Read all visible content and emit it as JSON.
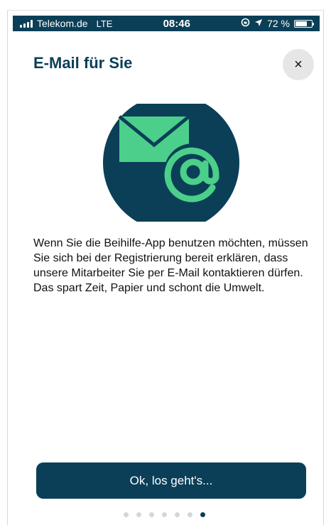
{
  "status_bar": {
    "carrier": "Telekom.de",
    "network": "LTE",
    "time": "08:46",
    "battery": "72 %",
    "battery_level_percent": 72,
    "icons": [
      "signal-icon",
      "orientation-lock-icon",
      "location-icon",
      "battery-icon"
    ]
  },
  "screen": {
    "title": "E-Mail für Sie",
    "close_label": "×",
    "body": "Wenn Sie die Beihilfe-App benutzen möchten, müssen Sie sich bei der Registrierung bereit erklären, dass unsere Mitarbeiter Sie per E-Mail kontaktieren dürfen. Das spart Zeit, Papier und schont die Umwelt.",
    "cta_label": "Ok, los geht's..."
  },
  "pagination": {
    "total": 7,
    "current": 7
  },
  "colors": {
    "primary": "#0b3f57",
    "accent": "#4ccf8a",
    "close_bg": "#e6e6e6",
    "dot_inactive": "#d6d6d6"
  },
  "illustration": {
    "icons": [
      "envelope-icon",
      "at-sign-icon"
    ]
  }
}
